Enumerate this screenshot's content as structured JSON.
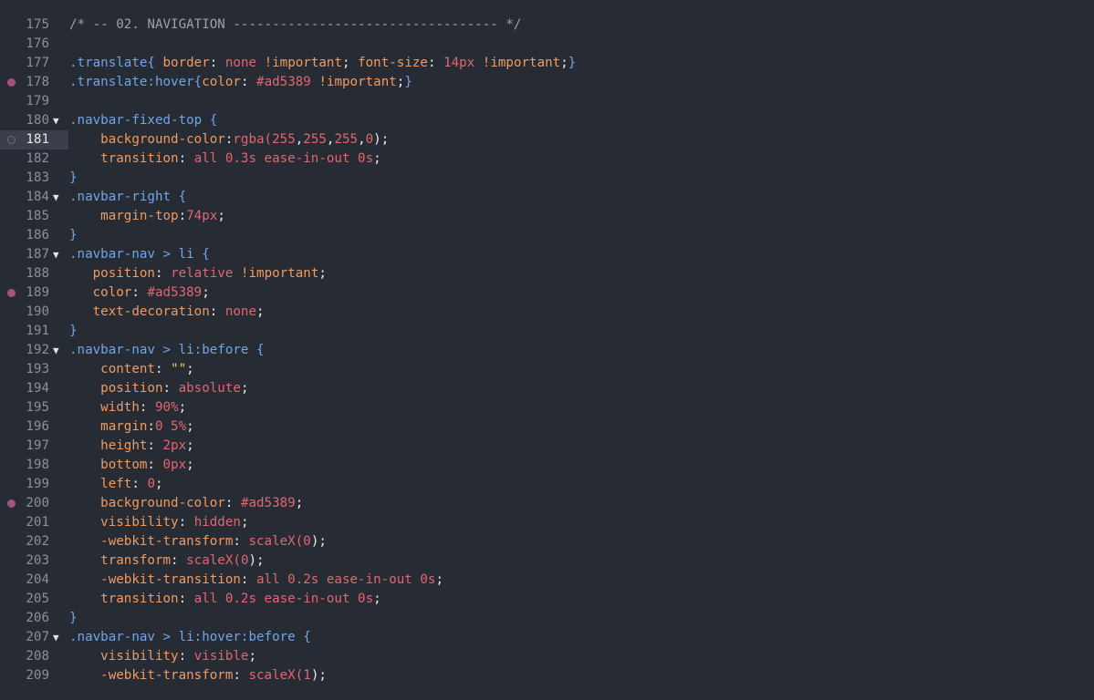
{
  "editor": {
    "lines": [
      {
        "num": "175",
        "tokens": [
          {
            "t": "/* -- 02. NAVIGATION ---------------------------------- */",
            "c": "comment"
          }
        ]
      },
      {
        "num": "176",
        "tokens": []
      },
      {
        "num": "177",
        "tokens": [
          {
            "t": ".translate",
            "c": "sel"
          },
          {
            "t": "{ ",
            "c": "brace"
          },
          {
            "t": "border",
            "c": "prop"
          },
          {
            "t": ": ",
            "c": "punc"
          },
          {
            "t": "none",
            "c": "val"
          },
          {
            "t": " ",
            "c": "punc"
          },
          {
            "t": "!important",
            "c": "prop"
          },
          {
            "t": "; ",
            "c": "punc"
          },
          {
            "t": "font-size",
            "c": "prop"
          },
          {
            "t": ": ",
            "c": "punc"
          },
          {
            "t": "14px",
            "c": "val"
          },
          {
            "t": " ",
            "c": "punc"
          },
          {
            "t": "!important",
            "c": "prop"
          },
          {
            "t": ";",
            "c": "punc"
          },
          {
            "t": "}",
            "c": "brace"
          }
        ]
      },
      {
        "num": "178",
        "dot": "filled",
        "tokens": [
          {
            "t": ".translate:hover",
            "c": "sel"
          },
          {
            "t": "{",
            "c": "brace"
          },
          {
            "t": "color",
            "c": "prop"
          },
          {
            "t": ": ",
            "c": "punc"
          },
          {
            "t": "#ad5389",
            "c": "val"
          },
          {
            "t": " ",
            "c": "punc"
          },
          {
            "t": "!important",
            "c": "prop"
          },
          {
            "t": ";",
            "c": "punc"
          },
          {
            "t": "}",
            "c": "brace"
          }
        ]
      },
      {
        "num": "179",
        "tokens": []
      },
      {
        "num": "180",
        "fold": true,
        "tokens": [
          {
            "t": ".navbar-fixed-top",
            "c": "sel"
          },
          {
            "t": " {",
            "c": "brace"
          }
        ]
      },
      {
        "num": "181",
        "active": true,
        "dot": "hollow",
        "tokens": [
          {
            "t": "    background-color",
            "c": "prop"
          },
          {
            "t": ":",
            "c": "punc"
          },
          {
            "t": "rgba(",
            "c": "val"
          },
          {
            "t": "255",
            "c": "val"
          },
          {
            "t": ",",
            "c": "punc"
          },
          {
            "t": "255",
            "c": "val"
          },
          {
            "t": ",",
            "c": "punc"
          },
          {
            "t": "255",
            "c": "val"
          },
          {
            "t": ",",
            "c": "punc"
          },
          {
            "t": "0",
            "c": "val"
          },
          {
            "t": ");",
            "c": "punc"
          }
        ]
      },
      {
        "num": "182",
        "tokens": [
          {
            "t": "    transition",
            "c": "prop"
          },
          {
            "t": ": ",
            "c": "punc"
          },
          {
            "t": "all 0.3s ease-in-out 0s",
            "c": "val"
          },
          {
            "t": ";",
            "c": "punc"
          }
        ]
      },
      {
        "num": "183",
        "tokens": [
          {
            "t": "}",
            "c": "brace"
          }
        ]
      },
      {
        "num": "184",
        "fold": true,
        "tokens": [
          {
            "t": ".navbar-right",
            "c": "sel"
          },
          {
            "t": " {",
            "c": "brace"
          }
        ]
      },
      {
        "num": "185",
        "tokens": [
          {
            "t": "    margin-top",
            "c": "prop"
          },
          {
            "t": ":",
            "c": "punc"
          },
          {
            "t": "74px",
            "c": "val"
          },
          {
            "t": ";",
            "c": "punc"
          }
        ]
      },
      {
        "num": "186",
        "tokens": [
          {
            "t": "}",
            "c": "brace"
          }
        ]
      },
      {
        "num": "187",
        "fold": true,
        "tokens": [
          {
            "t": ".navbar-nav > li",
            "c": "sel"
          },
          {
            "t": " {",
            "c": "brace"
          }
        ]
      },
      {
        "num": "188",
        "tokens": [
          {
            "t": "   position",
            "c": "prop"
          },
          {
            "t": ": ",
            "c": "punc"
          },
          {
            "t": "relative",
            "c": "val"
          },
          {
            "t": " ",
            "c": "punc"
          },
          {
            "t": "!important",
            "c": "prop"
          },
          {
            "t": ";",
            "c": "punc"
          }
        ]
      },
      {
        "num": "189",
        "dot": "filled",
        "tokens": [
          {
            "t": "   color",
            "c": "prop"
          },
          {
            "t": ": ",
            "c": "punc"
          },
          {
            "t": "#ad5389",
            "c": "val"
          },
          {
            "t": ";",
            "c": "punc"
          }
        ]
      },
      {
        "num": "190",
        "tokens": [
          {
            "t": "   text-decoration",
            "c": "prop"
          },
          {
            "t": ": ",
            "c": "punc"
          },
          {
            "t": "none",
            "c": "val"
          },
          {
            "t": ";",
            "c": "punc"
          }
        ]
      },
      {
        "num": "191",
        "tokens": [
          {
            "t": "}",
            "c": "brace"
          }
        ]
      },
      {
        "num": "192",
        "fold": true,
        "tokens": [
          {
            "t": ".navbar-nav > li:before",
            "c": "sel"
          },
          {
            "t": " {",
            "c": "brace"
          }
        ]
      },
      {
        "num": "193",
        "tokens": [
          {
            "t": "    content",
            "c": "prop"
          },
          {
            "t": ": ",
            "c": "punc"
          },
          {
            "t": "\"\"",
            "c": "str"
          },
          {
            "t": ";",
            "c": "punc"
          }
        ]
      },
      {
        "num": "194",
        "tokens": [
          {
            "t": "    position",
            "c": "prop"
          },
          {
            "t": ": ",
            "c": "punc"
          },
          {
            "t": "absolute",
            "c": "val"
          },
          {
            "t": ";",
            "c": "punc"
          }
        ]
      },
      {
        "num": "195",
        "tokens": [
          {
            "t": "    width",
            "c": "prop"
          },
          {
            "t": ": ",
            "c": "punc"
          },
          {
            "t": "90%",
            "c": "val"
          },
          {
            "t": ";",
            "c": "punc"
          }
        ]
      },
      {
        "num": "196",
        "tokens": [
          {
            "t": "    margin",
            "c": "prop"
          },
          {
            "t": ":",
            "c": "punc"
          },
          {
            "t": "0 5%",
            "c": "val"
          },
          {
            "t": ";",
            "c": "punc"
          }
        ]
      },
      {
        "num": "197",
        "tokens": [
          {
            "t": "    height",
            "c": "prop"
          },
          {
            "t": ": ",
            "c": "punc"
          },
          {
            "t": "2px",
            "c": "val"
          },
          {
            "t": ";",
            "c": "punc"
          }
        ]
      },
      {
        "num": "198",
        "tokens": [
          {
            "t": "    bottom",
            "c": "prop"
          },
          {
            "t": ": ",
            "c": "punc"
          },
          {
            "t": "0px",
            "c": "val"
          },
          {
            "t": ";",
            "c": "punc"
          }
        ]
      },
      {
        "num": "199",
        "tokens": [
          {
            "t": "    left",
            "c": "prop"
          },
          {
            "t": ": ",
            "c": "punc"
          },
          {
            "t": "0",
            "c": "val"
          },
          {
            "t": ";",
            "c": "punc"
          }
        ]
      },
      {
        "num": "200",
        "dot": "filled",
        "tokens": [
          {
            "t": "    background-color",
            "c": "prop"
          },
          {
            "t": ": ",
            "c": "punc"
          },
          {
            "t": "#ad5389",
            "c": "val"
          },
          {
            "t": ";",
            "c": "punc"
          }
        ]
      },
      {
        "num": "201",
        "tokens": [
          {
            "t": "    visibility",
            "c": "prop"
          },
          {
            "t": ": ",
            "c": "punc"
          },
          {
            "t": "hidden",
            "c": "val"
          },
          {
            "t": ";",
            "c": "punc"
          }
        ]
      },
      {
        "num": "202",
        "tokens": [
          {
            "t": "    -webkit-transform",
            "c": "prop"
          },
          {
            "t": ": ",
            "c": "punc"
          },
          {
            "t": "scaleX(",
            "c": "val"
          },
          {
            "t": "0",
            "c": "val"
          },
          {
            "t": ");",
            "c": "punc"
          }
        ]
      },
      {
        "num": "203",
        "tokens": [
          {
            "t": "    transform",
            "c": "prop"
          },
          {
            "t": ": ",
            "c": "punc"
          },
          {
            "t": "scaleX(",
            "c": "val"
          },
          {
            "t": "0",
            "c": "val"
          },
          {
            "t": ");",
            "c": "punc"
          }
        ]
      },
      {
        "num": "204",
        "tokens": [
          {
            "t": "    -webkit-transition",
            "c": "prop"
          },
          {
            "t": ": ",
            "c": "punc"
          },
          {
            "t": "all 0.2s ease-in-out 0s",
            "c": "val"
          },
          {
            "t": ";",
            "c": "punc"
          }
        ]
      },
      {
        "num": "205",
        "tokens": [
          {
            "t": "    transition",
            "c": "prop"
          },
          {
            "t": ": ",
            "c": "punc"
          },
          {
            "t": "all 0.2s ease-in-out 0s",
            "c": "val"
          },
          {
            "t": ";",
            "c": "punc"
          }
        ]
      },
      {
        "num": "206",
        "tokens": [
          {
            "t": "}",
            "c": "brace"
          }
        ]
      },
      {
        "num": "207",
        "fold": true,
        "tokens": [
          {
            "t": ".navbar-nav > li:hover:before",
            "c": "sel"
          },
          {
            "t": " {",
            "c": "brace"
          }
        ]
      },
      {
        "num": "208",
        "tokens": [
          {
            "t": "    visibility",
            "c": "prop"
          },
          {
            "t": ": ",
            "c": "punc"
          },
          {
            "t": "visible",
            "c": "val"
          },
          {
            "t": ";",
            "c": "punc"
          }
        ]
      },
      {
        "num": "209",
        "tokens": [
          {
            "t": "    -webkit-transform",
            "c": "prop"
          },
          {
            "t": ": ",
            "c": "punc"
          },
          {
            "t": "scaleX(",
            "c": "val"
          },
          {
            "t": "1",
            "c": "val"
          },
          {
            "t": ");",
            "c": "punc"
          }
        ]
      }
    ]
  },
  "colors": {
    "background": "#272b33",
    "comment": "#9ba1ab",
    "selector": "#6fa6ea",
    "property": "#f19a60",
    "value": "#e26671",
    "string": "#f0d15a",
    "marker": "#a4527f"
  },
  "icons": {
    "fold": "triangle-down-icon",
    "marker": "color-swatch-dot-icon"
  }
}
